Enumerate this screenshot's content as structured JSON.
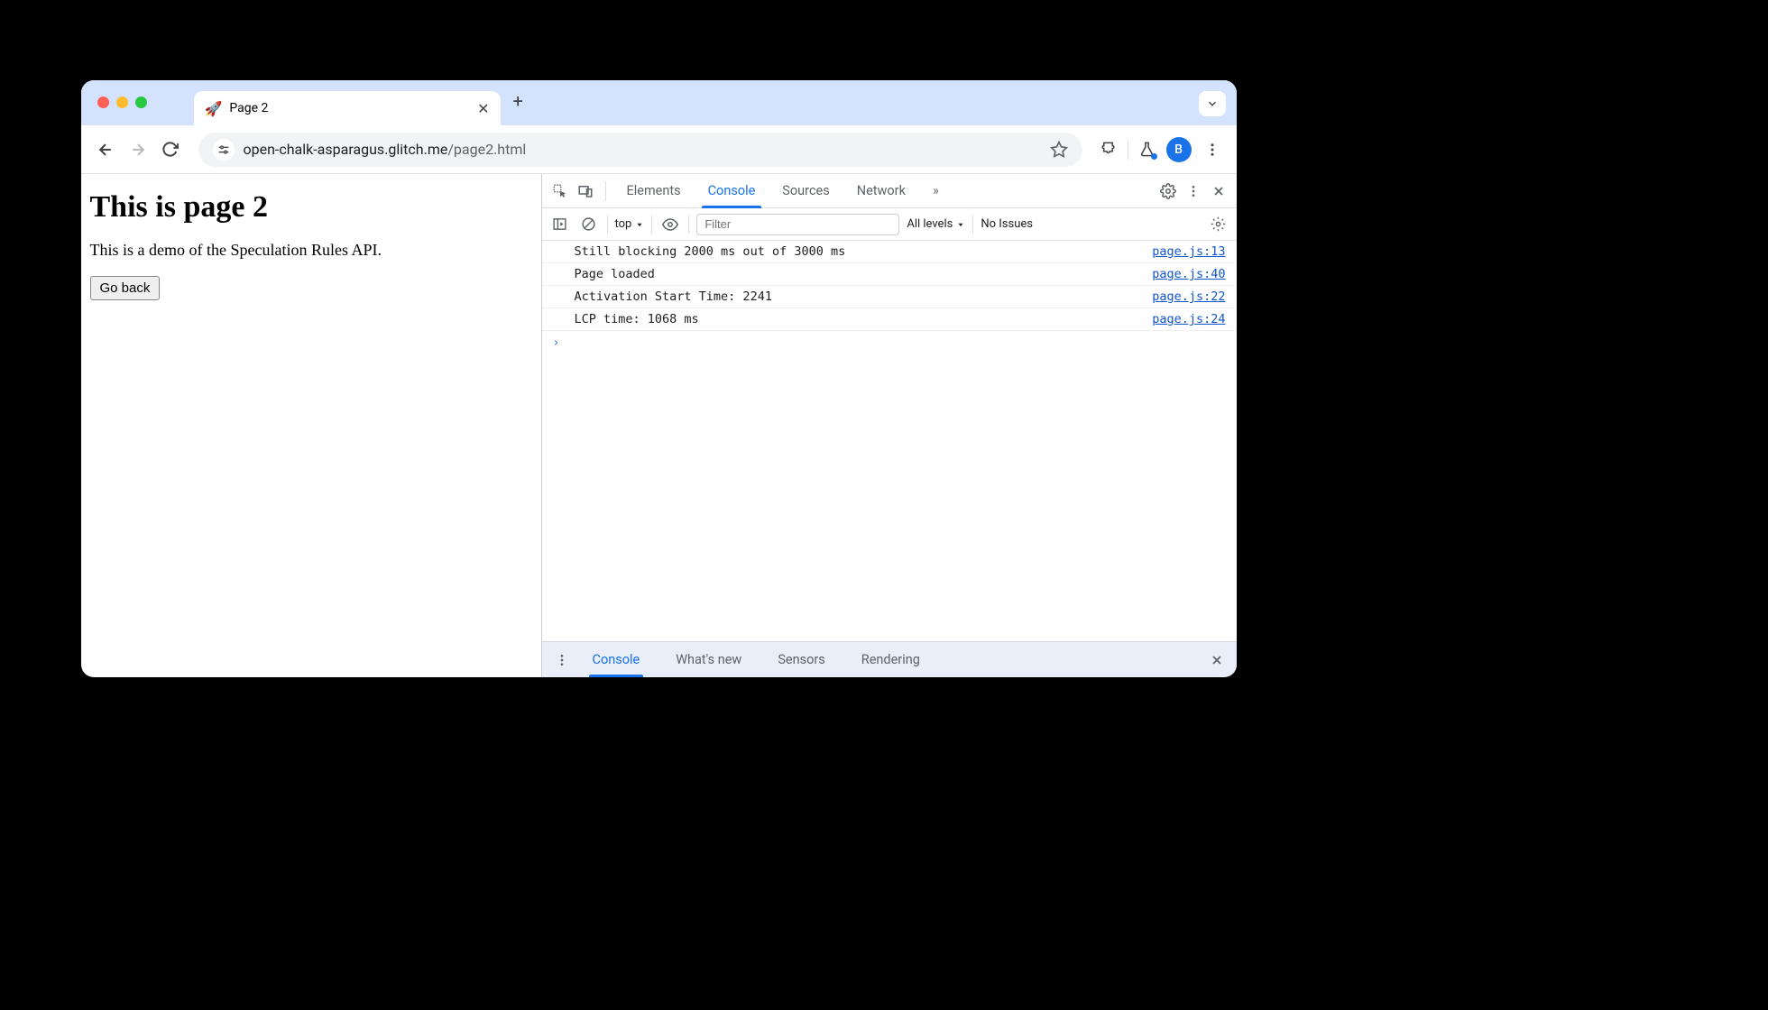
{
  "tab": {
    "favicon": "🚀",
    "title": "Page 2"
  },
  "url": {
    "host": "open-chalk-asparagus.glitch.me",
    "path": "/page2.html"
  },
  "avatar_initial": "B",
  "page": {
    "heading": "This is page 2",
    "paragraph": "This is a demo of the Speculation Rules API.",
    "button_label": "Go back"
  },
  "devtools": {
    "tabs": [
      "Elements",
      "Console",
      "Sources",
      "Network"
    ],
    "active_tab": "Console",
    "more_tabs_icon": "»",
    "toolbar": {
      "context": "top",
      "filter_placeholder": "Filter",
      "levels": "All levels",
      "issues": "No Issues"
    },
    "console": [
      {
        "msg": "Still blocking 2000 ms out of 3000 ms",
        "src": "page.js:13"
      },
      {
        "msg": "Page loaded",
        "src": "page.js:40"
      },
      {
        "msg": "Activation Start Time: 2241",
        "src": "page.js:22"
      },
      {
        "msg": "LCP time: 1068 ms",
        "src": "page.js:24"
      }
    ],
    "prompt": "›",
    "drawer_tabs": [
      "Console",
      "What's new",
      "Sensors",
      "Rendering"
    ],
    "drawer_active": "Console"
  }
}
